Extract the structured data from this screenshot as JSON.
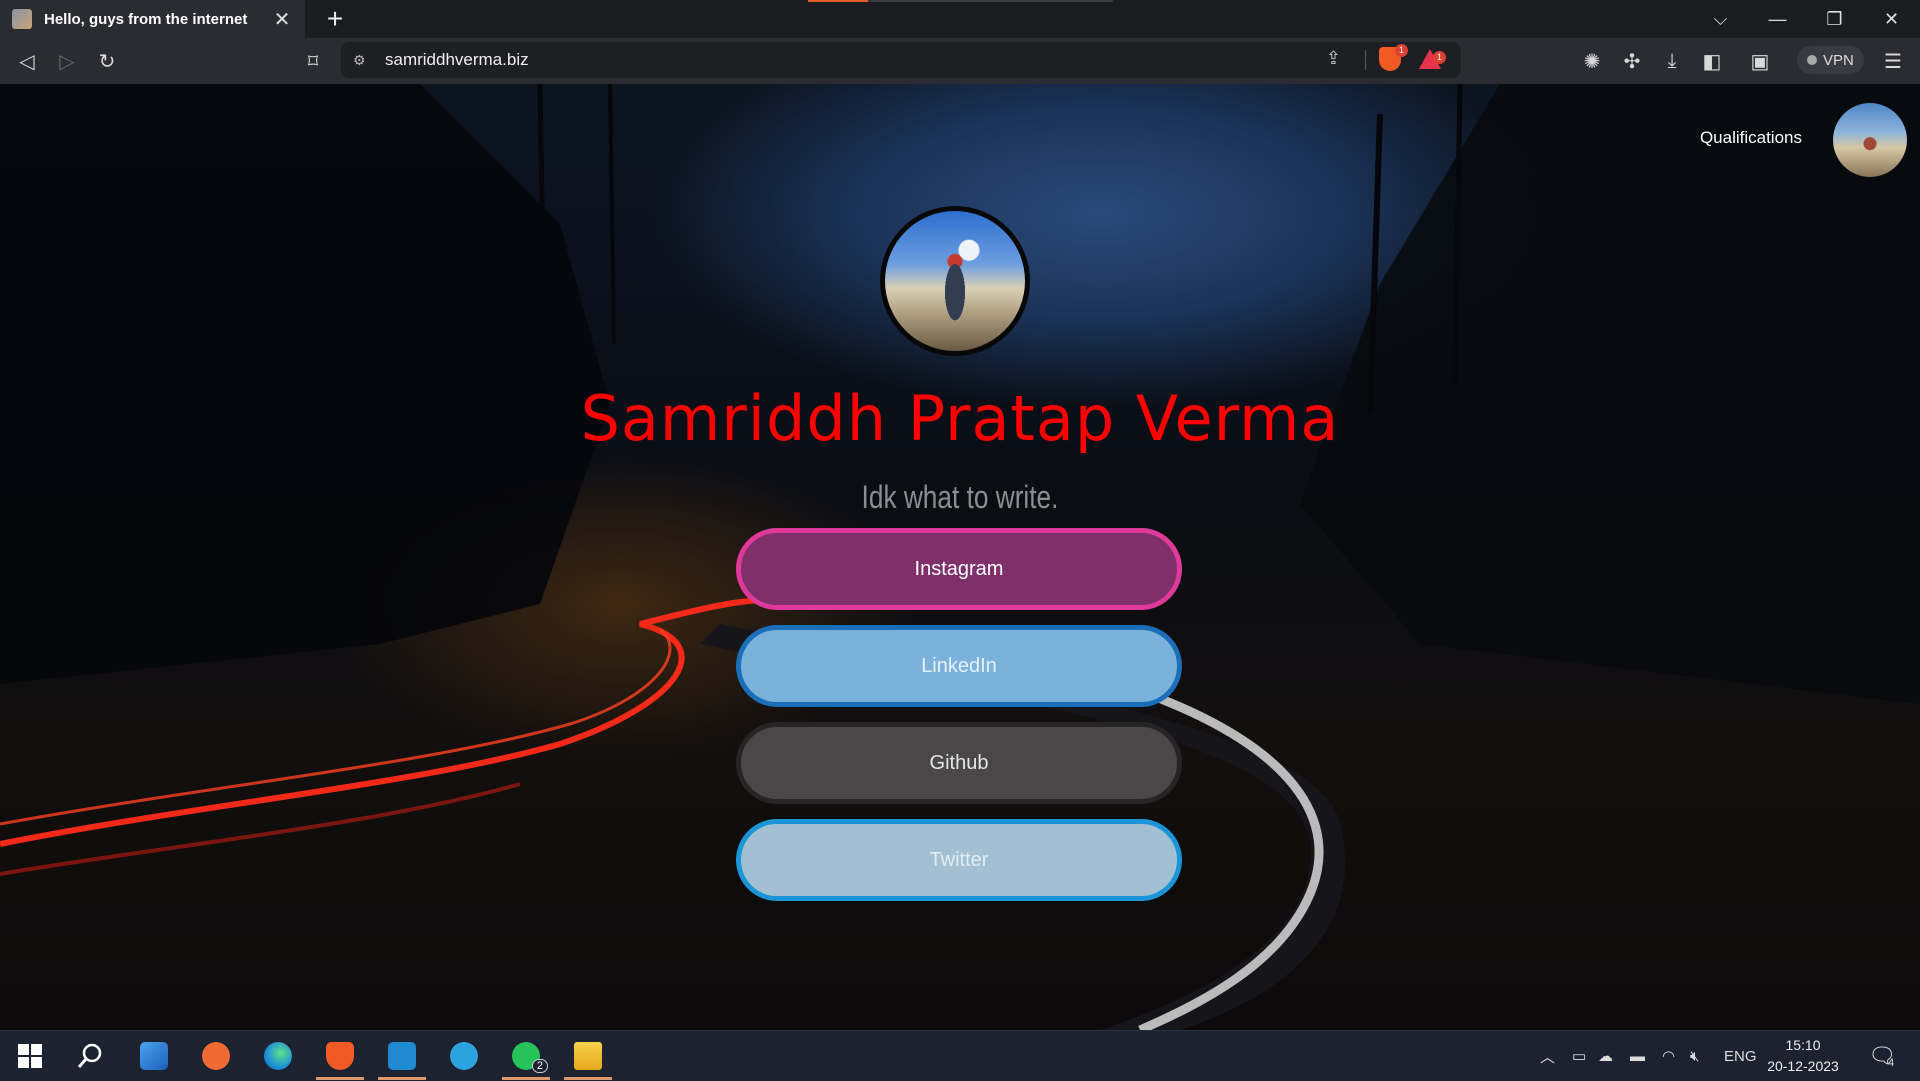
{
  "browser": {
    "tab_title": "Hello, guys from the internet",
    "new_tab": "+",
    "url": "samriddhverma.biz",
    "shield_badge": "1",
    "rewards_badge": "1",
    "vpn_label": "VPN"
  },
  "page": {
    "nav_qualifications": "Qualifications",
    "name": "Samriddh Pratap Verma",
    "tagline": "Idk what to write.",
    "links": [
      {
        "label": "Instagram"
      },
      {
        "label": "LinkedIn"
      },
      {
        "label": "Github"
      },
      {
        "label": "Twitter"
      }
    ]
  },
  "taskbar": {
    "whatsapp_badge": "2",
    "language": "ENG",
    "time": "15:10",
    "date": "20-12-2023",
    "notifications": "4"
  },
  "colors": {
    "name": "#ff0000",
    "instagram_border": "#e0399c",
    "linkedin_border": "#1a6fb8",
    "twitter_border": "#1a95d8"
  }
}
